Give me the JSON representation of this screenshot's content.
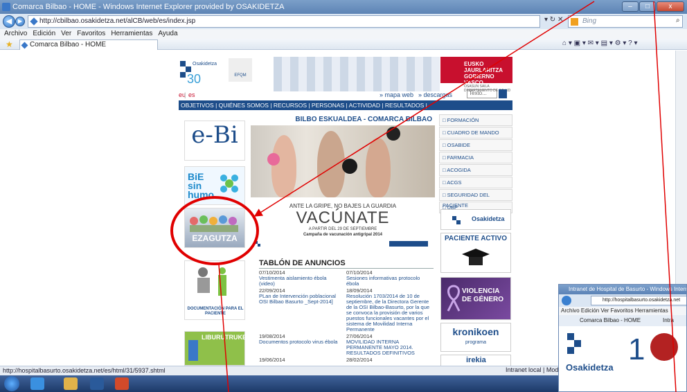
{
  "window": {
    "title": "Comarca Bilbao - HOME - Windows Internet Explorer provided by OSAKIDETZA",
    "minimize": "–",
    "maximize": "□",
    "close": "x"
  },
  "address": {
    "url": "http://cbilbao.osakidetza.net/alCB/web/es/index.jsp",
    "search_placeholder": "Bing"
  },
  "menu": [
    "Archivo",
    "Edición",
    "Ver",
    "Favoritos",
    "Herramientas",
    "Ayuda"
  ],
  "tab": {
    "label": "Comarca Bilbao - HOME"
  },
  "site": {
    "logo_text": "Osakidetza",
    "logo_sub": "EFQM",
    "gov_text": "EUSKO JAURLARITZA GOBIERNO VASCO",
    "gov_sub": "OSASUN SAILA DEPARTAMENTO DE SALUD",
    "lang_eu": "eu",
    "lang_es": "es",
    "link_mapa": "» mapa web",
    "link_descargas": "» descargas",
    "search_placeholder": "Texto...",
    "nav": "OBJETIVOS | QUIÉNES SOMOS | RECURSOS | PERSONAS | ACTIVIDAD | RESULTADOS |",
    "banner_title": "BILBO ESKUALDEA - COMARCA BILBAO",
    "vac_line1": "ANTE LA GRIPE, NO BAJES LA GUARDIA",
    "vac_big": "VACÚNATE",
    "vac_date": "A PARTIR DEL 29 DE SEPTIEMBRE",
    "vac_campaign": "Campaña de vacunación antigripal 2014",
    "left_boxes": {
      "ebi": "e-Bi",
      "bie": "BiE sin humo",
      "ezagutza": "EZAGUTZA",
      "documentacion": "DOCUMENTACIÓN PARA EL PACIENTE",
      "liburutruke": "LIBURUTRUKE"
    },
    "tablon": {
      "title": "TABLÓN DE ANUNCIOS",
      "rows": [
        [
          {
            "d": "07/10/2014",
            "t": "Vestimenta aislamiento ébola (video)"
          },
          {
            "d": "07/10/2014",
            "t": "Sesiones informativas protocolo ébola"
          }
        ],
        [
          {
            "d": "22/09/2014",
            "t": "PLan de Intervención poblacional OSI Bilbao Basurto _Sept-2014]"
          },
          {
            "d": "18/09/2014",
            "t": "Resolución 1703/2014 de 10 de septiembre, de la Directora Gerente de la OSI Bilbao-Basurto, por la que se convoca la provisión de varios puestos funcionales vacantes por el sistema de Movilidad Interna Permanente"
          }
        ],
        [
          {
            "d": "19/08/2014",
            "t": "Documentos protocolo virus ébola"
          },
          {
            "d": "27/06/2014",
            "t": "MOVILIDAD INTERNA PERMANENTE MAYO 2014. RESULTADOS DEFINITIVOS"
          }
        ],
        [
          {
            "d": "19/06/2014",
            "t": ""
          },
          {
            "d": "28/02/2014",
            "t": ""
          }
        ]
      ]
    },
    "right_menu": [
      "FORMACIÓN",
      "CUADRO DE MANDO",
      "OSABIDE",
      "FARMACIA",
      "ACOGIDA",
      "ACGS",
      "SEGURIDAD DEL PACIENTE",
      "UBP"
    ],
    "right_boxes": {
      "osakidetza": "Osakidetza",
      "paciente": "PACIENTE ACTIVO",
      "violencia": "VIOLENCIA DE GÉNERO",
      "kronikoen": "kronikoen",
      "kronikoen_sub": "programa",
      "irekia": "irekia"
    }
  },
  "status": {
    "url": "http://hospitalbasurto.osakidetza.net/es/html/31/5937.shtml",
    "zone": "Intranet local | Modo prote"
  },
  "win2": {
    "title": "Intranet de Hospital de Basurto - Windows Internet E",
    "url": "http://hospitalbasurto.osakidetza.net",
    "menu": "Archivo   Edición   Ver   Favoritos   Herramientas",
    "tab": "Comarca Bilbao - HOME",
    "tab2": "Intra",
    "logo": "Osakidetza"
  }
}
